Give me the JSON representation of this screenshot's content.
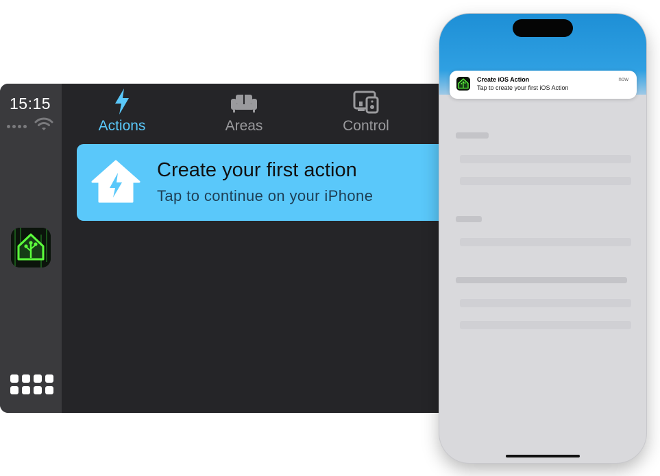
{
  "carplay": {
    "time": "15:15",
    "tabs": [
      {
        "label": "Actions",
        "icon": "bolt-icon",
        "active": true
      },
      {
        "label": "Areas",
        "icon": "sofa-icon",
        "active": false
      },
      {
        "label": "Control",
        "icon": "devices-icon",
        "active": false
      }
    ],
    "card": {
      "title": "Create your first action",
      "subtitle": "Tap to continue on your iPhone",
      "icon": "home-bolt-icon"
    },
    "side_app_icon": "home-assistant-app-icon",
    "dashboard_icon": "app-grid-icon"
  },
  "phone": {
    "notification": {
      "title": "Create iOS Action",
      "body": "Tap to create your first iOS Action",
      "time": "now",
      "icon": "home-assistant-app-icon"
    }
  },
  "colors": {
    "accent": "#5ac8fa",
    "carplay_bg": "#252528",
    "carplay_sidebar": "#3a3a3d",
    "phone_header": "#2fa0e2"
  }
}
